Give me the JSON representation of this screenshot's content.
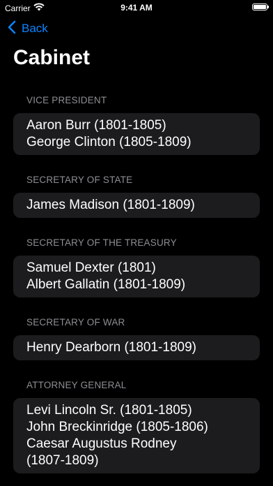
{
  "status_bar": {
    "carrier": "Carrier",
    "time": "9:41 AM",
    "battery_level": 1.0
  },
  "nav": {
    "back_label": "Back",
    "back_icon": "chevron-left-icon",
    "accent_color": "#0a84ff"
  },
  "page": {
    "title": "Cabinet"
  },
  "sections": [
    {
      "header": "VICE PRESIDENT",
      "lines": [
        "Aaron Burr (1801-1805)",
        "George Clinton (1805-1809)"
      ]
    },
    {
      "header": "SECRETARY OF STATE",
      "lines": [
        "James Madison (1801-1809)"
      ]
    },
    {
      "header": "SECRETARY OF THE TREASURY",
      "lines": [
        "Samuel Dexter (1801)",
        "Albert Gallatin (1801-1809)"
      ]
    },
    {
      "header": "SECRETARY OF WAR",
      "lines": [
        "Henry Dearborn (1801-1809)"
      ]
    },
    {
      "header": "ATTORNEY GENERAL",
      "lines": [
        "Levi Lincoln Sr. (1801-1805)",
        "John Breckinridge (1805-1806)",
        "Caesar Augustus Rodney",
        "(1807-1809)"
      ]
    }
  ]
}
